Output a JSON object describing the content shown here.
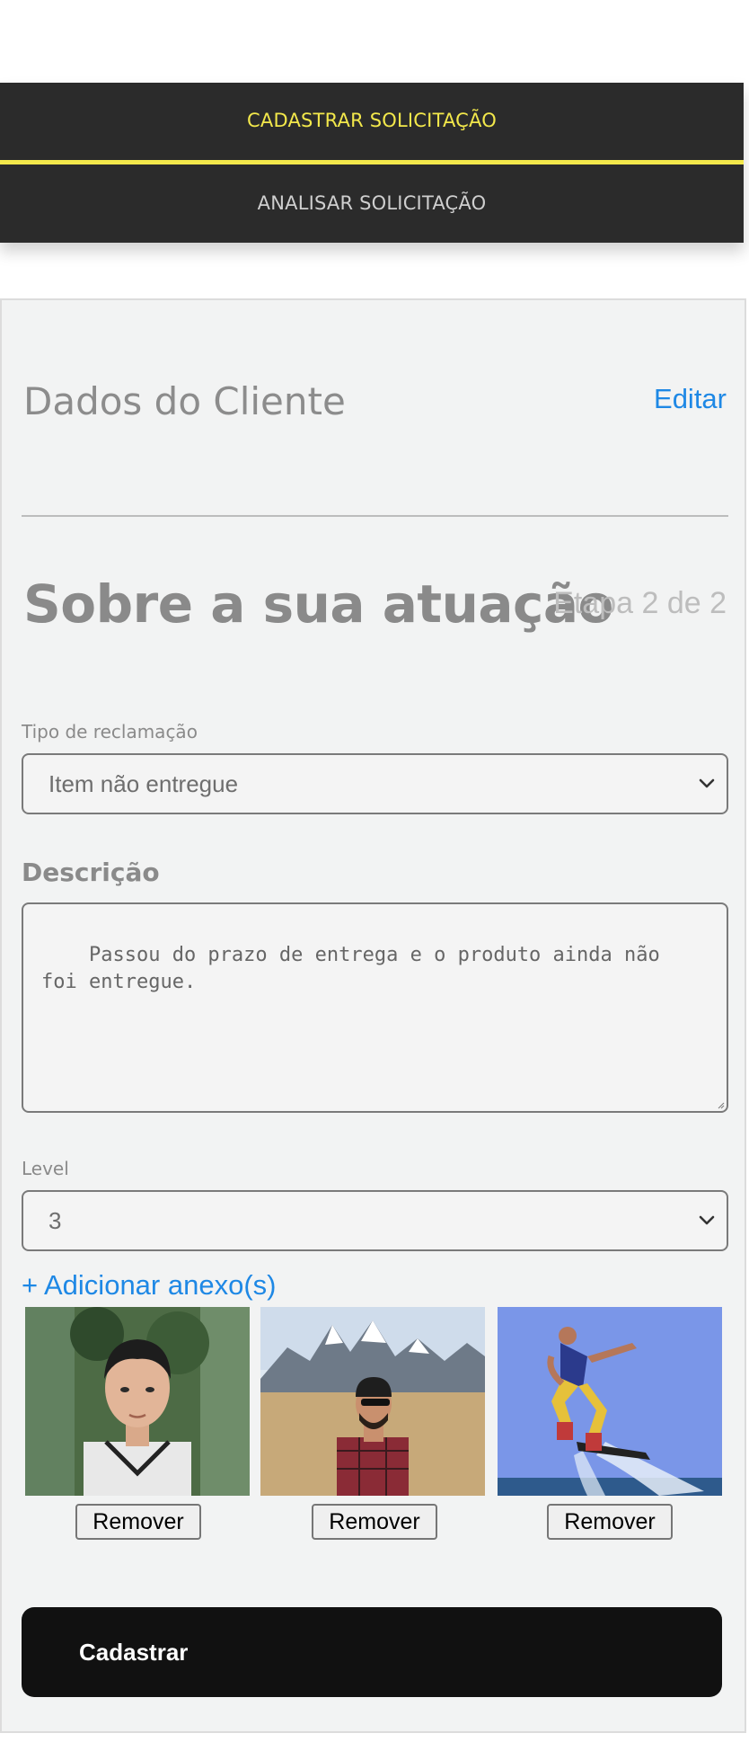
{
  "nav": {
    "tabs": [
      {
        "label": "CADASTRAR SOLICITAÇÃO",
        "active": true
      },
      {
        "label": "ANALISAR SOLICITAÇÃO",
        "active": false
      }
    ],
    "accent_color": "#f3e84b"
  },
  "client_section": {
    "title": "Dados do Cliente",
    "edit_label": "Editar"
  },
  "step": {
    "title": "Sobre a sua atuação",
    "counter": "Etapa 2 de 2"
  },
  "form": {
    "complaint_type": {
      "label": "Tipo de reclamação",
      "value": "Item não entregue"
    },
    "description": {
      "label": "Descrição",
      "value": "Passou do prazo de entrega e o produto ainda não\nfoi entregue."
    },
    "level": {
      "label": "Level",
      "value": "3"
    },
    "attach_label": "+ Adicionar anexo(s)",
    "attachments": [
      {
        "icon": "portrait-photo-icon",
        "remove_label": "Remover"
      },
      {
        "icon": "road-mountain-photo-icon",
        "remove_label": "Remover"
      },
      {
        "icon": "flyboard-photo-icon",
        "remove_label": "Remover"
      }
    ],
    "submit_label": "Cadastrar"
  }
}
